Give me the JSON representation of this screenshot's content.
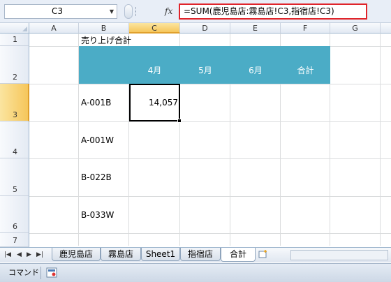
{
  "name_box": {
    "value": "C3"
  },
  "formula_bar": {
    "fx_label": "fx",
    "formula": "=SUM(鹿児島店:霧島店!C3,指宿店!C3)"
  },
  "columns": [
    "A",
    "B",
    "C",
    "D",
    "E",
    "F",
    "G"
  ],
  "selected_column": "C",
  "rows": [
    "1",
    "2",
    "3",
    "4",
    "5",
    "6",
    "7"
  ],
  "selected_row": "3",
  "cells": {
    "B1": "売り上げ合計",
    "C2": "4月",
    "D2": "5月",
    "E2": "6月",
    "F2": "合計",
    "B3": "A-001B",
    "C3": "14,057",
    "B4": "A-001W",
    "B5": "B-022B",
    "B6": "B-033W"
  },
  "header_band_color": "#4bacc6",
  "sheet_nav": [
    "first-sheet",
    "prev-sheet",
    "next-sheet",
    "last-sheet"
  ],
  "sheet_tabs": [
    "鹿児島店",
    "霧島店",
    "Sheet1",
    "指宿店",
    "合計"
  ],
  "active_sheet": "合計",
  "status_bar": {
    "mode": "コマンド"
  },
  "icons": [
    "dropdown-arrow-icon",
    "fx-icon",
    "new-sheet-icon",
    "macro-record-icon"
  ]
}
